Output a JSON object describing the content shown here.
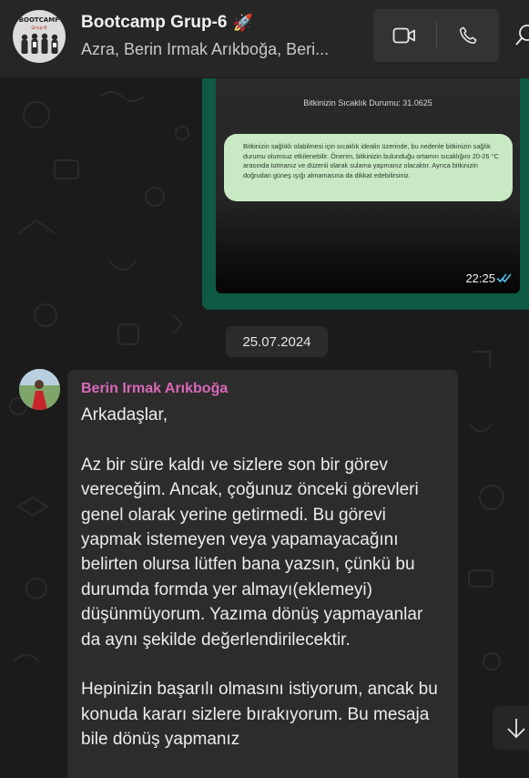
{
  "header": {
    "group_title": "Bootcamp Grup-6",
    "title_emoji": "🚀",
    "members": "Azra, Berin Irmak Arıkboğa, Beri...",
    "avatar_text_top": "BOOTCAMP",
    "avatar_text_bottom": "Grup-6"
  },
  "image_message": {
    "temperature_line": "Bitkinizin Sıcaklık Durumu: 31.0625",
    "advice_text": "Bitkinizin sağlıklı olabilmesi için sıcaklık idealin üzerinde, bu nedenle bitkinizin sağlık durumu olumsuz etkilenebilir. Önerim, bitkinizin bulunduğu ortamın sıcaklığını 20-26 °C arasında tutmanız ve düzenli olarak sulama yapmanız olacaktır. Ayrıca bitkinizin doğrudan güneş ışığı almamasına da dikkat edebilirsiniz.",
    "time": "22:25"
  },
  "date_separator": "25.07.2024",
  "message": {
    "sender": "Berin Irmak Arıkboğa",
    "text": "Arkadaşlar,\n\nAz bir süre kaldı ve sizlere son bir görev vereceğim. Ancak, çoğunuz önceki görevleri genel olarak yerine getirmedi. Bu görevi yapmak istemeyen veya yapamayacağını belirten olursa lütfen bana yazsın, çünkü bu durumda formda yer almayı(eklemeyi) düşünmüyorum. Yazıma dönüş yapmayanlar da aynı şekilde değerlendirilecektir.\n\nHepinizin başarılı olmasını istiyorum, ancak bu konuda kararı sizlere bırakıyorum. Bu mesaja bile dönüş yapmanız"
  },
  "colors": {
    "header_bg": "#262626",
    "sent_bubble": "#0e5a44",
    "received_bubble": "#2c2c2c",
    "sender_name": "#d868b8",
    "read_ticks": "#53bdeb"
  },
  "icons": {
    "video_call": "video-camera-icon",
    "voice_call": "phone-icon",
    "search": "search-icon",
    "read_receipt": "double-check-icon",
    "scroll_down": "arrow-down-icon"
  }
}
